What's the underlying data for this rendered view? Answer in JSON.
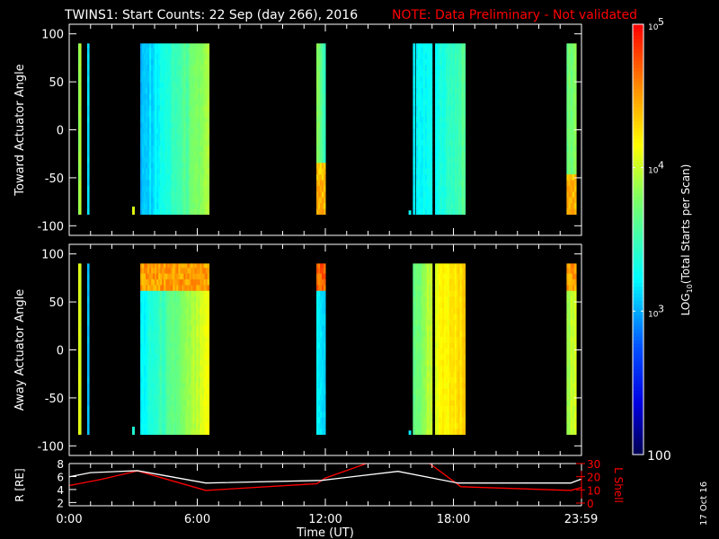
{
  "title": {
    "main": "TWINS1: Start Counts: 22 Sep (day 266), 2016",
    "note": "NOTE: Data Preliminary - Not validated",
    "note_color": "#ff0000"
  },
  "date_stamp": "17 Oct 16",
  "chart_data": [
    {
      "type": "heatmap",
      "name": "toward",
      "ylabel": "Toward Actuator Angle",
      "ylim": [
        -110,
        110
      ],
      "yticks": [
        "100",
        "50",
        "0",
        "-50",
        "-100"
      ],
      "ytick_values": [
        100,
        50,
        0,
        -50,
        -100
      ],
      "angle_range": [
        -88,
        90
      ],
      "segments": [
        {
          "start": 0.42,
          "end": 0.55,
          "level_start": 3.9,
          "level_end": 3.9
        },
        {
          "start": 0.84,
          "end": 0.93,
          "level_start": 3.2,
          "level_end": 3.2
        },
        {
          "start": 2.95,
          "end": 3.05,
          "level_start": 4.0,
          "level_end": 4.0,
          "angle_range": [
            -88,
            -80
          ]
        },
        {
          "start": 3.33,
          "end": 6.55,
          "level_start": 3.0,
          "level_end": 3.9
        },
        {
          "start": 11.58,
          "end": 12.0,
          "level_start": 3.8,
          "level_end": 3.5,
          "band": {
            "from": -88,
            "to": -40,
            "level": 4.4
          }
        },
        {
          "start": 15.9,
          "end": 16.0,
          "level_start": 3.2,
          "level_end": 3.2,
          "angle_range": [
            -88,
            -84
          ]
        },
        {
          "start": 16.1,
          "end": 16.2,
          "level_start": 3.2,
          "level_end": 3.2
        },
        {
          "start": 16.25,
          "end": 17.0,
          "level_start": 3.2,
          "level_end": 3.3
        },
        {
          "start": 17.14,
          "end": 18.55,
          "level_start": 3.3,
          "level_end": 3.6
        },
        {
          "start": 23.3,
          "end": 23.75,
          "level_start": 3.7,
          "level_end": 3.8,
          "band": {
            "from": -88,
            "to": -50,
            "level": 4.4
          }
        }
      ]
    },
    {
      "type": "heatmap",
      "name": "away",
      "ylabel": "Away Actuator Angle",
      "xlabel": "Time (UT)",
      "ylim": [
        -110,
        110
      ],
      "yticks": [
        "100",
        "50",
        "0",
        "-50",
        "-100"
      ],
      "ytick_values": [
        100,
        50,
        0,
        -50,
        -100
      ],
      "angle_range": [
        -88,
        90
      ],
      "segments": [
        {
          "start": 0.42,
          "end": 0.55,
          "level_start": 4.0,
          "level_end": 4.0
        },
        {
          "start": 0.84,
          "end": 0.93,
          "level_start": 3.1,
          "level_end": 3.1
        },
        {
          "start": 2.95,
          "end": 3.05,
          "level_start": 3.3,
          "level_end": 3.3,
          "angle_range": [
            -88,
            -80
          ]
        },
        {
          "start": 3.33,
          "end": 6.55,
          "level_start": 3.2,
          "level_end": 4.1,
          "band": {
            "from": 62,
            "to": 90,
            "level": 4.5
          }
        },
        {
          "start": 11.58,
          "end": 12.0,
          "level_start": 3.2,
          "level_end": 3.1,
          "band": {
            "from": 65,
            "to": 90,
            "level": 4.7
          }
        },
        {
          "start": 15.9,
          "end": 16.0,
          "level_start": 3.2,
          "level_end": 3.2,
          "angle_range": [
            -88,
            -84
          ]
        },
        {
          "start": 16.1,
          "end": 17.0,
          "level_start": 3.6,
          "level_end": 4.0
        },
        {
          "start": 17.14,
          "end": 18.55,
          "level_start": 4.1,
          "level_end": 4.3
        },
        {
          "start": 23.3,
          "end": 23.75,
          "level_start": 3.9,
          "level_end": 4.0,
          "band": {
            "from": 60,
            "to": 90,
            "level": 4.5
          }
        }
      ]
    },
    {
      "type": "line",
      "name": "orbit",
      "xlabel": "Time (UT)",
      "xticks": [
        "0:00",
        "6:00",
        "12:00",
        "18:00",
        "23:59"
      ],
      "xtick_values": [
        0,
        6,
        12,
        18,
        23.98
      ],
      "xlim": [
        0,
        24
      ],
      "ylabel": "R [RE]",
      "ylim": [
        1.5,
        8
      ],
      "yticks": [
        "8",
        "6",
        "4",
        "2"
      ],
      "ytick_values": [
        8,
        6,
        4,
        2
      ],
      "y2label": "L Shell",
      "y2lim": [
        0,
        30
      ],
      "y2ticks": [
        "30",
        "20",
        "10",
        "0"
      ],
      "y2tick_values": [
        30,
        20,
        10,
        0
      ],
      "series": [
        {
          "name": "R",
          "color": "#ffffff",
          "x": [
            0,
            1,
            3.2,
            6.4,
            11.8,
            15.4,
            18.2,
            23.5,
            23.98
          ],
          "y": [
            5.96,
            6.6,
            6.9,
            5.0,
            5.4,
            6.8,
            5.0,
            5.0,
            5.6
          ]
        },
        {
          "name": "L Shell",
          "color": "#ff0000",
          "x": [
            0,
            1.5,
            3.2,
            6.4,
            11.6,
            12.0,
            14.1,
            16.8,
            18.35,
            23.5,
            23.98
          ],
          "y": [
            13.3,
            18,
            24.4,
            9.6,
            14.7,
            19,
            31,
            31,
            12.4,
            9.6,
            11.8
          ]
        }
      ]
    }
  ],
  "colorbar": {
    "label": "LOG10(Total Starts per Scan)",
    "label_main": "LOG",
    "label_sub": "10",
    "label_rest": "(Total Starts per Scan)",
    "range_log": [
      2,
      5
    ],
    "ticks": [
      {
        "base": "10",
        "exp": "5",
        "value": 5
      },
      {
        "base": "10",
        "exp": "4",
        "value": 4
      },
      {
        "base": "10",
        "exp": "3",
        "value": 3
      },
      {
        "base": "100",
        "exp": "",
        "value": 2
      }
    ]
  }
}
